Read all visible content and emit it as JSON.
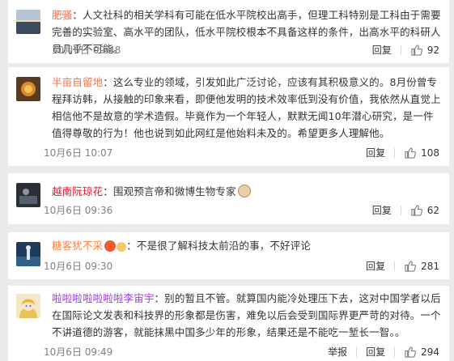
{
  "comments": [
    {
      "username": "肥骚",
      "text": "：人文社科的相关学科有可能在低水平院校出高手，但理工科特别是工科由于需要完善的实验室、高水平的团队，低水平院校根本不具备这样的条件，出高水平的科研人员几乎不可能。",
      "time": "10月6日 09:48",
      "reply_label": "回复",
      "likes": "92",
      "avatar": "sunset-sea-avatar"
    },
    {
      "username": "半亩自留地",
      "text": "：这么专业的领域，引发如此广泛讨论，应该有其积极意义的。8月份曾专程拜访韩，从接触的印象来看，即便他发明的技术效率低到没有价值，我依然从直觉上相信他不是故意的学术造假。毕竟作为一个年轻人，默默无闻10年潜心研究，是一件值得尊敬的行为！他也说到如此网红是他始料未及的。希望更多人理解他。",
      "time": "10月6日 10:07",
      "reply_label": "回复",
      "likes": "108",
      "avatar": "brown-sun-avatar"
    },
    {
      "username": "越南阮琼花",
      "text": "：围观预言帝和微博生物专家",
      "time": "10月6日 09:36",
      "reply_label": "回复",
      "likes": "62",
      "avatar": "dark-scene-avatar"
    },
    {
      "username": "糖客犹不采",
      "text": "：不是很了解科技太前沿的事，不好评论",
      "time": "10月6日 09:30",
      "reply_label": "回复",
      "likes": "281",
      "avatar": "blue-figure-avatar"
    },
    {
      "username": "啦啦啦啦啦啦啦李宙宇",
      "text": "：别的暂且不管。就算国内能冷处理压下去，这对中国学者以后在国际论文发表和科技界的形象都是伤害，难免以后会受到国际界更严苛的对待。一个不讲道德的游客，就能抹黑中国多少年的形象，结果还是不能吃一堑长一智。。",
      "time": "10月6日 09:49",
      "report_label": "举报",
      "reply_label": "回复",
      "likes": "294",
      "avatar": "anime-girl-avatar"
    }
  ],
  "colors": {
    "username": "#eb7350",
    "text": "#333333",
    "meta": "#808080",
    "background": "#e9ebed"
  }
}
